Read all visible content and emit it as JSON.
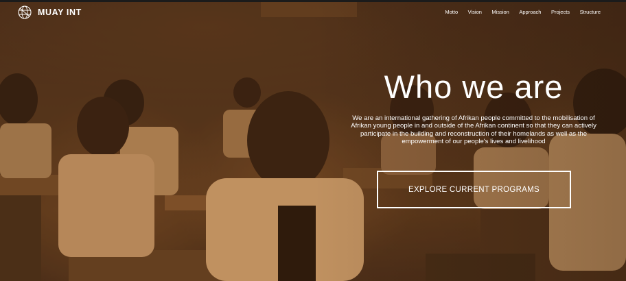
{
  "brand": {
    "name": "MUAY INT",
    "logo_icon": "globe-icon"
  },
  "nav": {
    "items": [
      {
        "label": "Motto"
      },
      {
        "label": "Vision"
      },
      {
        "label": "Mission"
      },
      {
        "label": "Approach"
      },
      {
        "label": "Projects"
      },
      {
        "label": "Structure"
      }
    ]
  },
  "hero": {
    "title": "Who we are",
    "description": "We are an international gathering of Afrikan people committed to the mobilisation of Afrikan young people in and outside of the Afrikan continent so that they can actively participate in the building and reconstruction of their homelands as well as the empowerment of our people's lives and livelihood",
    "cta_label": "EXPLORE CURRENT PROGRAMS",
    "overlay_tint": "#8a5a2b"
  }
}
